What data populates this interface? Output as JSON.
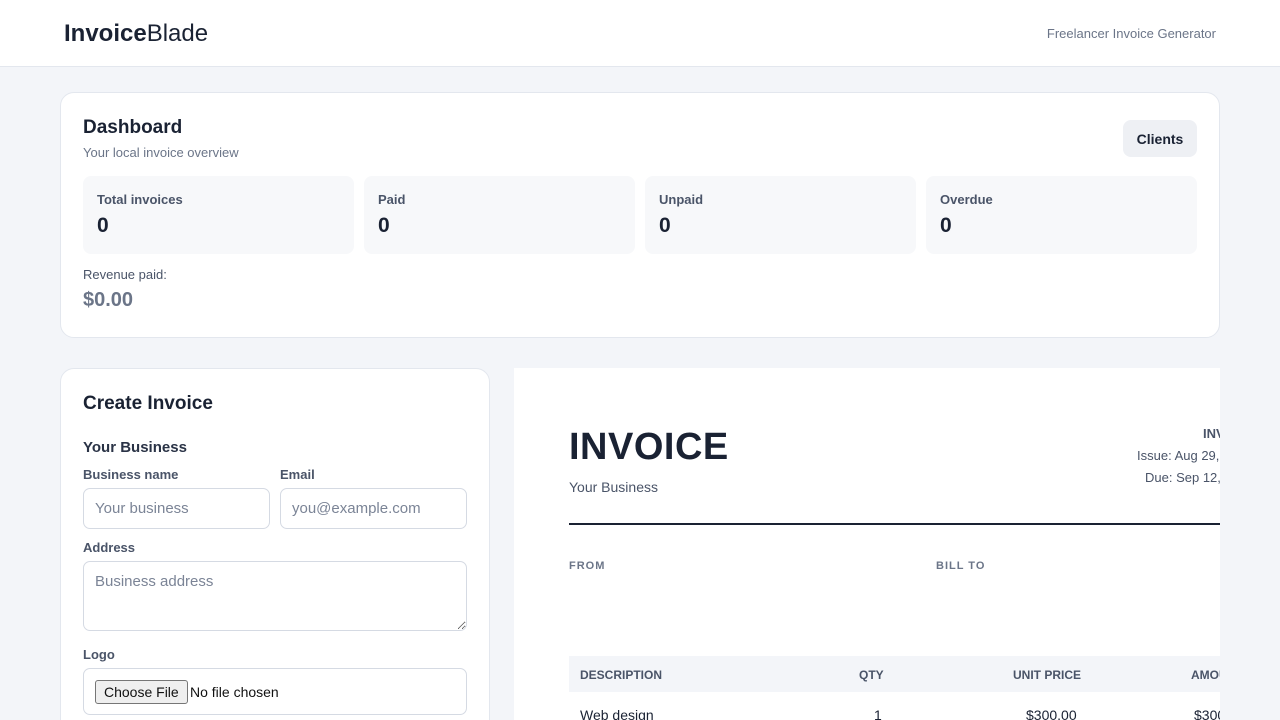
{
  "header": {
    "brand_bold": "Invoice",
    "brand_light": "Blade",
    "tagline": "Freelancer Invoice Generator"
  },
  "dashboard": {
    "title": "Dashboard",
    "subtitle": "Your local invoice overview",
    "clients_button": "Clients",
    "stats": [
      {
        "label": "Total invoices",
        "value": "0"
      },
      {
        "label": "Paid",
        "value": "0"
      },
      {
        "label": "Unpaid",
        "value": "0"
      },
      {
        "label": "Overdue",
        "value": "0"
      }
    ],
    "revenue_label": "Revenue paid:",
    "revenue_value": "$0.00"
  },
  "create": {
    "title": "Create Invoice",
    "section": "Your Business",
    "business_name_label": "Business name",
    "business_name_placeholder": "Your business",
    "business_name_value": "",
    "email_label": "Email",
    "email_placeholder": "you@example.com",
    "email_value": "",
    "address_label": "Address",
    "address_placeholder": "Business address",
    "logo_label": "Logo",
    "file_button": "Choose File",
    "file_status": "No file chosen"
  },
  "preview": {
    "title": "INVOICE",
    "business": "Your Business",
    "number_fragment": "INV",
    "issue_fragment": "Issue: Aug 29,",
    "due_fragment": "Due: Sep 12,",
    "from_label": "FROM",
    "bill_to_label": "BILL TO",
    "columns": [
      "DESCRIPTION",
      "QTY",
      "UNIT PRICE",
      "AMOU"
    ],
    "rows": [
      {
        "description": "Web design",
        "qty": "1",
        "unit_price": "$300.00",
        "amount": "$300"
      }
    ]
  },
  "colors": {
    "background": "#f3f5f9",
    "text": "#1a2233",
    "muted": "#6b7588"
  }
}
